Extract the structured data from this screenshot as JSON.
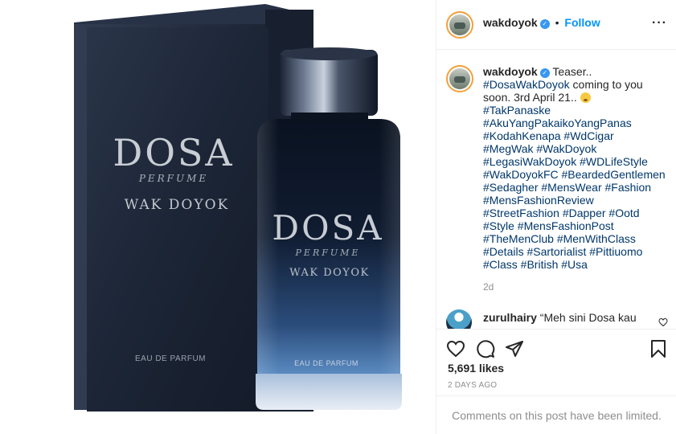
{
  "post_image": {
    "box_brand": "DOSA",
    "box_sub": "PERFUME",
    "box_name": "WAK DOYOK",
    "box_footer": "EAU DE PARFUM",
    "bottle_brand": "DOSA",
    "bottle_sub": "PERFUME",
    "bottle_name": "WAK DOYOK",
    "bottle_footer": "EAU DE PARFUM"
  },
  "header": {
    "username": "wakdoyok",
    "verified_icon": "verified-badge-icon",
    "separator": "•",
    "follow_label": "Follow",
    "more_label": "···"
  },
  "caption": {
    "username": "wakdoyok",
    "intro": "Teaser..",
    "first_tag": "#DosaWakDoyok",
    "first_text": " coming to you soon. 3rd April 21.. ",
    "lines": [
      "#TakPanaske",
      "#AkuYangPakaikoYangPanas",
      "#KodahKenapa #WdCigar",
      "#MegWak #WakDoyok",
      "#LegasiWakDoyok #WDLifeStyle",
      "#WakDoyokFC #BeardedGentlemen",
      "#Sedagher #MensWear #Fashion",
      "#MensFashionReview",
      "#StreetFashion #Dapper #Ootd",
      "#Style #MensFashionPost",
      "#TheMenClub #MenWithClass",
      "#Details #Sartorialist #Pittiuomo",
      "#Class #British #Usa"
    ],
    "time_ago": "2d"
  },
  "comment": {
    "username": "zurulhairy",
    "text": "“Meh sini Dosa kau"
  },
  "engagement": {
    "likes": "5,691 likes",
    "posted": "2 DAYS AGO"
  },
  "footer": {
    "limited": "Comments on this post have been limited."
  },
  "colors": {
    "link": "#00376b",
    "follow": "#0095f6",
    "muted": "#8e8e8e",
    "box": "#1f2a3c",
    "bottle_top": "#0d1626",
    "bottle_bottom": "#4a7ab5"
  }
}
